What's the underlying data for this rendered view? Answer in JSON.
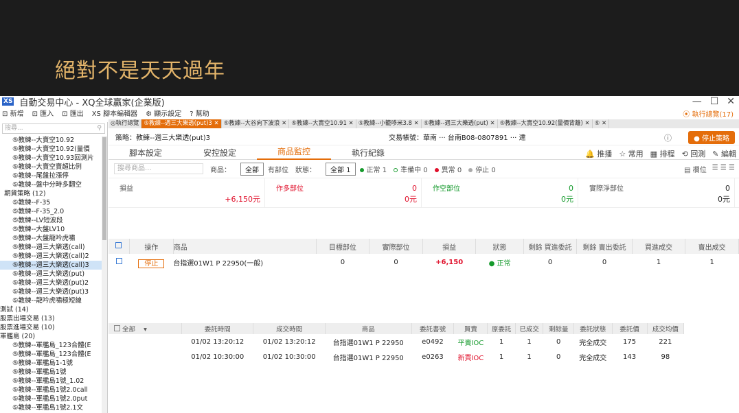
{
  "slide_title": "絕對不是天天過年",
  "window": {
    "logo": "XS",
    "title": "自動交易中心 - XQ全球贏家(企業版)"
  },
  "menu": [
    "新增",
    "匯入",
    "匯出",
    "腳本編輯器",
    "顯示設定",
    "幫助"
  ],
  "exec_total": "⦿ 執行總覽(17)",
  "search_placeholder": "搜尋...",
  "tree": [
    {
      "t": "⑤教練--大賣空10.92",
      "lv": 2
    },
    {
      "t": "⑤教練--大賣空10.92(量價",
      "lv": 2
    },
    {
      "t": "⑤教練--大賣空10.93回測片",
      "lv": 2
    },
    {
      "t": "⑤教練--大賣空賣超比例",
      "lv": 2
    },
    {
      "t": "⑤教練--尾盤拉漲停",
      "lv": 2
    },
    {
      "t": "⑤教練--盤中分時多翻空",
      "lv": 2
    },
    {
      "t": "期貨策略 (12)",
      "lv": 1
    },
    {
      "t": "⑤教練--F-35",
      "lv": 2
    },
    {
      "t": "⑤教練--F-35_2.0",
      "lv": 2
    },
    {
      "t": "⑤教練--LV短波段",
      "lv": 2
    },
    {
      "t": "⑤教練--大盤LV10",
      "lv": 2
    },
    {
      "t": "⑤教練--大盤龍吟虎嘯",
      "lv": 2
    },
    {
      "t": "⑤教練--週三大樂透(call)",
      "lv": 2
    },
    {
      "t": "⑤教練--週三大樂透(call)2",
      "lv": 2
    },
    {
      "t": "⑤教練--週三大樂透(call)3",
      "lv": 2,
      "sel": true
    },
    {
      "t": "⑤教練--週三大樂透(put)",
      "lv": 2
    },
    {
      "t": "⑤教練--週三大樂透(put)2",
      "lv": 2
    },
    {
      "t": "⑤教練--週三大樂透(put)3",
      "lv": 2
    },
    {
      "t": "⑤教練--龍吟虎嘯極短線",
      "lv": 2
    },
    {
      "t": "測試 (14)",
      "lv": 0
    },
    {
      "t": "股票出場交易 (13)",
      "lv": 0
    },
    {
      "t": "股票進場交易 (10)",
      "lv": 0
    },
    {
      "t": "軍艦島 (20)",
      "lv": 0
    },
    {
      "t": "⑤教練--軍艦島_123合體(E",
      "lv": 2
    },
    {
      "t": "⑤教練--軍艦島_123合體(E",
      "lv": 2
    },
    {
      "t": "⑤教練--軍艦島1-1號",
      "lv": 2
    },
    {
      "t": "⑤教練--軍艦島1號",
      "lv": 2
    },
    {
      "t": "⑤教練--軍艦島1號_1.02",
      "lv": 2
    },
    {
      "t": "⑤教練--軍艦島1號2.0call",
      "lv": 2
    },
    {
      "t": "⑤教練--軍艦島1號2.0put",
      "lv": 2
    },
    {
      "t": "⑤教練--軍艦島1號2.1文",
      "lv": 2
    }
  ],
  "tabs": [
    {
      "t": "◎執行總覽",
      "active": false
    },
    {
      "t": "⑤教練--週三大樂透(put)3 ✕",
      "active": true
    },
    {
      "t": "⑤教練--大谷向下波浪 ✕",
      "active": false
    },
    {
      "t": "⑤教練--大賣空10.91 ✕",
      "active": false
    },
    {
      "t": "⑤教練--小籠哆米3.8 ✕",
      "active": false
    },
    {
      "t": "⑤教練--週三大樂透(put) ✕",
      "active": false
    },
    {
      "t": "⑤教練--大賣空10.92(量價背離) ✕",
      "active": false
    },
    {
      "t": "⑤ ✕",
      "active": false
    }
  ],
  "strategy_label": "策略：教練--週三大樂透(put)3",
  "account_label": "交易帳號：華南 ··· 台南B08-0807891 ··· 達",
  "stop_strategy": "停止策略",
  "subtabs": [
    "腳本設定",
    "安控設定",
    "商品監控",
    "執行紀錄"
  ],
  "active_subtab": 2,
  "tools": [
    "推播",
    "常用",
    "排程",
    "回測",
    "編輯"
  ],
  "filters": {
    "search_placeholder": "搜尋商品...",
    "product_label": "商品：",
    "all_btn": "全部",
    "has_pos": "有部位",
    "status_label": "狀態：",
    "all_count": "全部 1",
    "normal": "正常 1",
    "ready": "準備中 0",
    "abnormal": "異常 0",
    "stopped": "停止 0",
    "columns": "欄位"
  },
  "summary": [
    {
      "label": "損益",
      "v1": "",
      "v2": "+6,150元",
      "v2color": "#e0102b"
    },
    {
      "label": "作多部位",
      "v1": "0",
      "v2": "0元",
      "v1color": "#e0102b",
      "v2color": "#e0102b",
      "lcolor": "#e0102b"
    },
    {
      "label": "作空部位",
      "v1": "0",
      "v2": "0元",
      "v1color": "#159a2c",
      "v2color": "#159a2c",
      "lcolor": "#159a2c"
    },
    {
      "label": "實際淨部位",
      "v1": "0",
      "v2": "0元"
    }
  ],
  "pos_headers": [
    "操作",
    "商品",
    "目標部位",
    "實際部位",
    "損益",
    "狀態",
    "剩餘 買進委託",
    "剩餘 賣出委託",
    "買進成交",
    "賣出成交"
  ],
  "pos_rows": [
    {
      "op": "停止",
      "product": "台指選01W1 P 22950(一般)",
      "target": "0",
      "actual": "0",
      "pnl": "+6,150",
      "status": "● 正常",
      "rbuy": "0",
      "rsell": "0",
      "buy": "1",
      "sell": "1"
    }
  ],
  "ord_filter": "全部",
  "ord_headers": [
    "委託時間",
    "成交時間",
    "商品",
    "委託書號",
    "買賣",
    "原委託",
    "已成交",
    "剩餘量",
    "委託狀態",
    "委託價",
    "成交均價"
  ],
  "ord_rows": [
    {
      "ot": "01/02 13:20:12",
      "ft": "01/02 13:20:12",
      "product": "台指選01W1 P 22950",
      "no": "e0492",
      "side": "平賣IOC",
      "sidecolor": "#159a2c",
      "orig": "1",
      "filled": "1",
      "rem": "0",
      "status": "完全成交",
      "price": "175",
      "avg": "221"
    },
    {
      "ot": "01/02 10:30:00",
      "ft": "01/02 10:30:00",
      "product": "台指選01W1 P 22950",
      "no": "e0263",
      "side": "新買IOC",
      "sidecolor": "#e0102b",
      "orig": "1",
      "filled": "1",
      "rem": "0",
      "status": "完全成交",
      "price": "143",
      "avg": "98"
    }
  ]
}
